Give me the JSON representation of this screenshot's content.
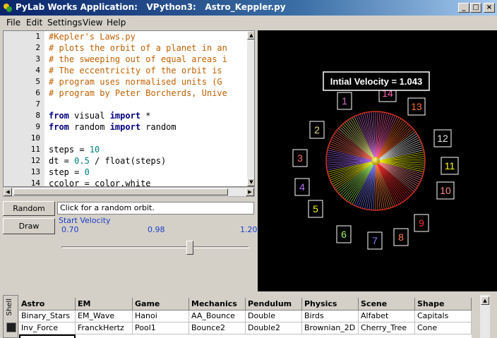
{
  "window": {
    "title": "PyLab Works Application:   VPython3:   Astro_Keppler.py",
    "minimize": "_",
    "maximize": "□",
    "close": "×"
  },
  "menu": [
    "File",
    "Edit",
    "Settings",
    "View",
    "Help"
  ],
  "editor": {
    "lines": [
      {
        "n": "1",
        "text": "#Kepler's Laws.py"
      },
      {
        "n": "2",
        "text": "# plots the orbit of a planet in an"
      },
      {
        "n": "3",
        "text": "# the sweeping out of equal areas i"
      },
      {
        "n": "4",
        "text": "# The eccentricity of the orbit is"
      },
      {
        "n": "5",
        "text": "# program uses normalised units (G"
      },
      {
        "n": "6",
        "text": "# program by Peter Borcherds, Unive"
      },
      {
        "n": "7",
        "text": ""
      },
      {
        "n": "8",
        "text": "from visual import *"
      },
      {
        "n": "9",
        "text": "from random import random"
      },
      {
        "n": "10",
        "text": ""
      },
      {
        "n": "11",
        "text": "steps = 10"
      },
      {
        "n": "12",
        "text": "dt = 0.5 / float(steps)"
      },
      {
        "n": "13",
        "text": "step = 0"
      },
      {
        "n": "14",
        "text": "ccolor = color.white"
      }
    ]
  },
  "controls": {
    "random_label": "Random",
    "draw_label": "Draw",
    "info_text": "Click for a random orbit.",
    "slider_title": "Start Velocity",
    "slider_min": "0.70",
    "slider_mid": "0.98",
    "slider_max": "1.20",
    "slider_value": 1.043
  },
  "scene": {
    "velocity_label": "Intial Velocity = 1.043",
    "numbers": [
      {
        "text": "1",
        "color": "#d070d0"
      },
      {
        "text": "2",
        "color": "#e0e080"
      },
      {
        "text": "3",
        "color": "#ff7060"
      },
      {
        "text": "4",
        "color": "#b070ff"
      },
      {
        "text": "5",
        "color": "#f0f020"
      },
      {
        "text": "6",
        "color": "#a0f060"
      },
      {
        "text": "7",
        "color": "#8080ff"
      },
      {
        "text": "8",
        "color": "#ff8040"
      },
      {
        "text": "9",
        "color": "#ff3030"
      },
      {
        "text": "10",
        "color": "#ff9090"
      },
      {
        "text": "11",
        "color": "#ffff00"
      },
      {
        "text": "12",
        "color": "#e0e0e0"
      },
      {
        "text": "13",
        "color": "#ff7030"
      },
      {
        "text": "14",
        "color": "#ff60b0"
      }
    ]
  },
  "shell_tab": "Shell",
  "grid": {
    "headers": [
      "Astro",
      "EM",
      "Game",
      "Mechanics",
      "Pendulum",
      "Physics",
      "Scene",
      "Shape"
    ],
    "rows": [
      [
        "Binary_Stars",
        "EM_Wave",
        "Hanoi",
        "AA_Bounce",
        "Double",
        "Birds",
        "Alfabet",
        "Capitals"
      ],
      [
        "Inv_Force",
        "FranckHertz",
        "Pool1",
        "Bounce2",
        "Double2",
        "Brownian_2D",
        "Cherry_Tree",
        "Cone"
      ]
    ]
  }
}
